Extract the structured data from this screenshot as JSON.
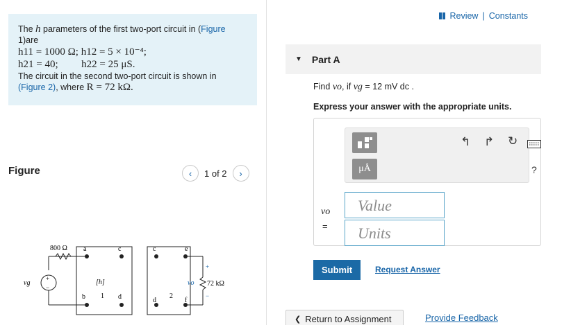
{
  "problem": {
    "intro_prefix": "The",
    "intro_h": "h",
    "intro_text": "parameters of the first two-port circuit in (",
    "figure1_link": "Figure",
    "figure1_tail": "1)are",
    "line1": "h11 = 1000 Ω; h12 = 5 × 10⁻⁴;",
    "line2a": "h21 = 40;",
    "line2b": "h22 = 25 μS.",
    "circuit_text": "The circuit in the second two-port circuit is shown in",
    "figure2_link": "(Figure 2)",
    "where_text": ", where",
    "where_value": "R = 72 kΩ."
  },
  "figure": {
    "title": "Figure",
    "pager_text": "1 of 2",
    "prev_icon": "‹",
    "next_icon": "›"
  },
  "circuit": {
    "r_source": "800 Ω",
    "source_label": "vg",
    "h_label": "[h]",
    "port1": "1",
    "port2": "2",
    "nodes": [
      "a",
      "b",
      "c",
      "d",
      "c",
      "d",
      "e",
      "f"
    ],
    "vo_label": "vo",
    "r_load": "72 kΩ",
    "plus": "+",
    "minus": "−"
  },
  "header": {
    "review": "Review",
    "separator": "|",
    "constants": "Constants"
  },
  "part": {
    "title": "Part A",
    "find_prefix": "Find",
    "find_var": "vo",
    "find_if": ", if",
    "find_given_var": "vg",
    "find_given_val": "= 12 mV dc .",
    "instruction": "Express your answer with the appropriate units."
  },
  "answer": {
    "variable": "vo",
    "equals": "=",
    "value_placeholder": "Value",
    "units_placeholder": "Units",
    "unit_btn": "μÅ",
    "help": "?"
  },
  "actions": {
    "submit": "Submit",
    "request": "Request Answer",
    "return": "Return to Assignment",
    "return_icon": "❮",
    "feedback": "Provide Feedback"
  },
  "colors": {
    "accent": "#1865a8",
    "info_bg": "#e4f2f8",
    "submit_bg": "#1b6aa6"
  }
}
